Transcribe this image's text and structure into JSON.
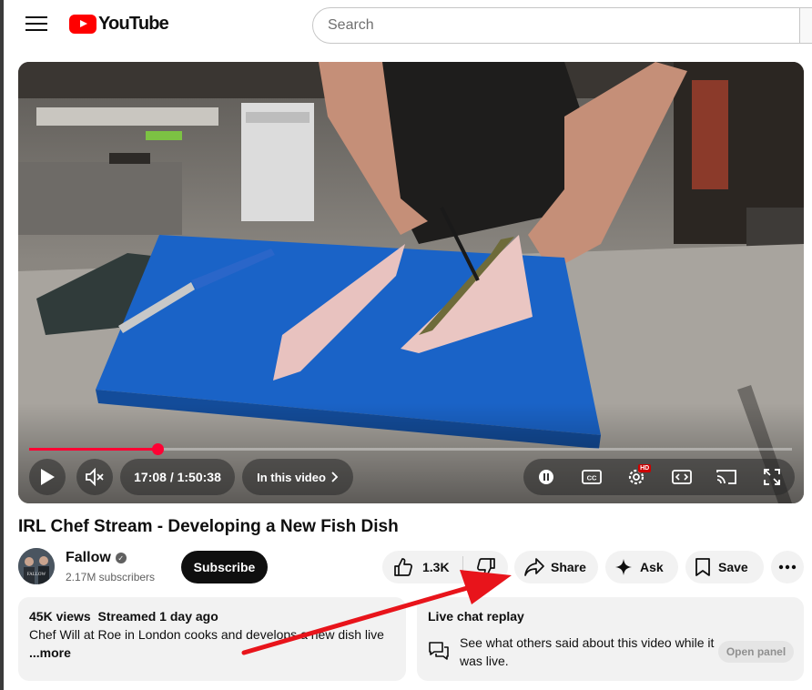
{
  "header": {
    "logo_text": "YouTube",
    "search_placeholder": "Search",
    "menu_icon": "hamburger-menu-icon"
  },
  "player": {
    "time_display": "17:08 / 1:50:38",
    "chapter_label": "In this video",
    "progress_fraction": 0.168,
    "hd_badge": "HD",
    "accent_color": "#ff0033",
    "icons": [
      "play-icon",
      "mute-icon",
      "pause-icon",
      "captions-icon",
      "settings-icon",
      "theater-icon",
      "cast-icon",
      "fullscreen-icon"
    ]
  },
  "video": {
    "title": "IRL Chef Stream - Developing a New Fish Dish"
  },
  "channel": {
    "name": "Fallow",
    "subscribers": "2.17M subscribers",
    "subscribe_label": "Subscribe",
    "verified": true
  },
  "actions": {
    "like_count": "1.3K",
    "share_label": "Share",
    "ask_label": "Ask",
    "save_label": "Save"
  },
  "description": {
    "meta": "45K views  Streamed 1 day ago",
    "text": "Chef Will at Roe in London cooks and develops a new dish live",
    "more_label": "...more"
  },
  "live_chat": {
    "title": "Live chat replay",
    "description": "See what others said about this video while it was live.",
    "open_panel_label": "Open panel"
  },
  "annotation": {
    "arrow_color": "#e8141b"
  }
}
